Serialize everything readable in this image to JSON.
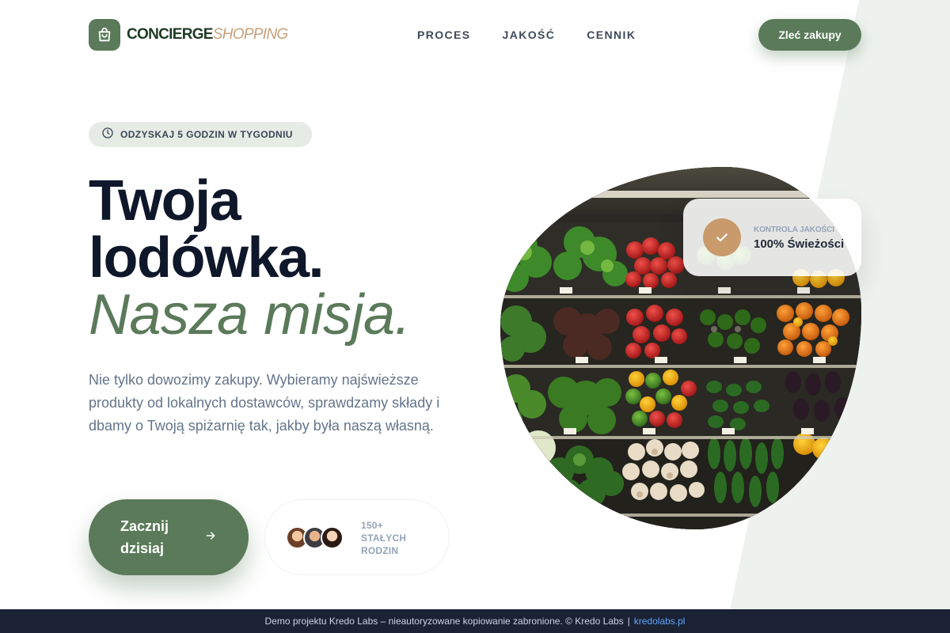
{
  "brand": {
    "name_part1": "CONCIERGE",
    "name_part2": "SHOPPING",
    "icon": "shopping-bag-icon"
  },
  "nav": {
    "items": [
      {
        "label": "PROCES"
      },
      {
        "label": "JAKOŚĆ"
      },
      {
        "label": "CENNIK"
      }
    ]
  },
  "header": {
    "cta_label": "Zleć zakupy"
  },
  "hero": {
    "badge": {
      "icon": "clock-icon",
      "text": "ODZYSKAJ 5 GODZIN W TYGODNIU"
    },
    "title_line1": "Twoja",
    "title_line2": "lodówka.",
    "title_accent": "Nasza misja.",
    "lead": "Nie tylko dowozimy zakupy. Wybieramy najświeższe produkty od lokalnych dostawców, sprawdzamy składy i dbamy o Twoją spiżarnię tak, jakby była naszą własną.",
    "cta_label": "Zacznij dzisiaj",
    "cta_icon": "arrow-right-icon",
    "social_proof": {
      "label": "150+ STAŁYCH RODZIN",
      "avatar_count": 3
    }
  },
  "quality_card": {
    "icon": "check-icon",
    "eyebrow": "KONTROLA JAKOŚCI",
    "value": "100% Świeżości"
  },
  "footer": {
    "text": "Demo projektu Kredo Labs – nieautoryzowane kopiowanie zabronione. © Kredo Labs",
    "separator": "|",
    "link_label": "kredolabs.pl"
  },
  "colors": {
    "brand_green": "#5a7a5a",
    "brand_tan": "#c8a07a",
    "ink": "#0f172a",
    "muted": "#64748b",
    "footer_bg": "#1a2234",
    "link": "#60a5fa"
  }
}
